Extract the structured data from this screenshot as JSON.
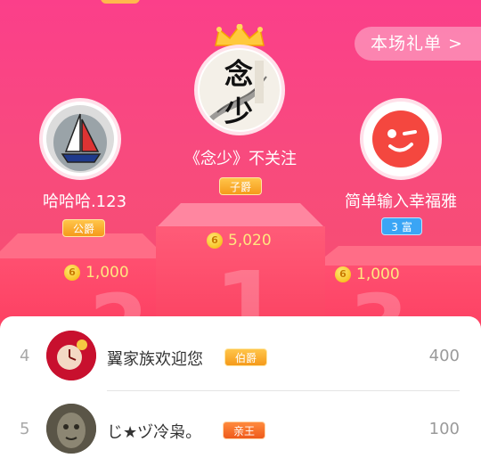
{
  "header": {
    "gift_list_label": "本场礼单 >"
  },
  "podium": {
    "first": {
      "rank": "1",
      "name": "《念少》不关注",
      "badge": "子爵",
      "score": "5,020",
      "avatar_text": "念\n少",
      "avatar_text_top": "念",
      "avatar_text_bottom": "少"
    },
    "second": {
      "rank": "2",
      "name": "哈哈哈.123",
      "badge": "公爵",
      "score": "1,000"
    },
    "third": {
      "rank": "3",
      "name": "简单输入幸福雅",
      "badge": "3 富",
      "score": "1,000"
    },
    "coin_glyph": "6"
  },
  "list": [
    {
      "rank": "4",
      "name": "翼家族欢迎您",
      "badge": "伯爵",
      "value": "400"
    },
    {
      "rank": "5",
      "name": "じ★ヅ冷枭。",
      "badge": "亲王",
      "value": "100"
    }
  ],
  "colors": {
    "background_top": "#fb3f8a",
    "background_bottom": "#f6506c",
    "score_text": "#ffe680",
    "badge_gold": "#f59a1a",
    "badge_blue": "#3aa5f5"
  }
}
